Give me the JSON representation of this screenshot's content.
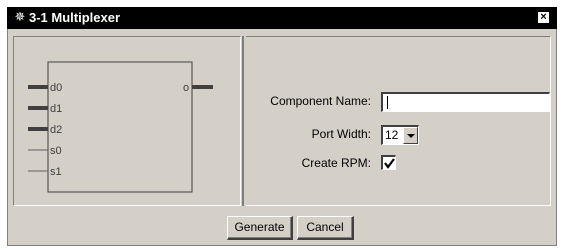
{
  "window": {
    "title": "3-1 Multiplexer",
    "icon": "gear-icon",
    "close_icon": "close-icon"
  },
  "symbol": {
    "inputs": [
      {
        "name": "d0",
        "bus": true
      },
      {
        "name": "d1",
        "bus": true
      },
      {
        "name": "d2",
        "bus": true
      },
      {
        "name": "s0",
        "bus": false
      },
      {
        "name": "s1",
        "bus": false
      }
    ],
    "outputs": [
      {
        "name": "o",
        "bus": true
      }
    ]
  },
  "form": {
    "component_name_label": "Component Name:",
    "component_name_value": "",
    "port_width_label": "Port Width:",
    "port_width_value": "12",
    "create_rpm_label": "Create RPM:",
    "create_rpm_checked": true
  },
  "buttons": {
    "generate": "Generate",
    "cancel": "Cancel"
  }
}
